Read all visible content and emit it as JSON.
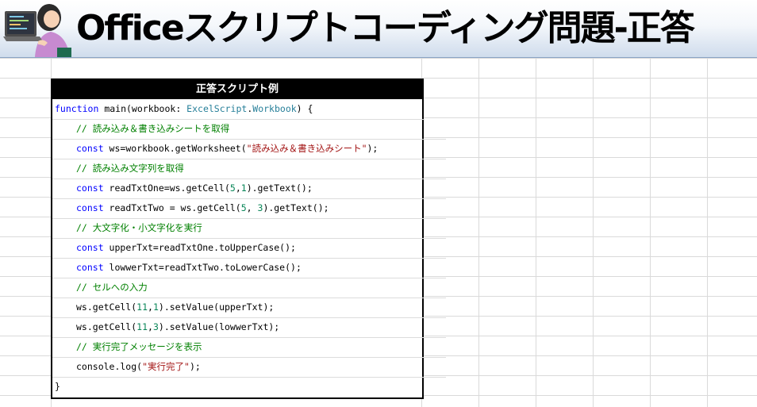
{
  "banner": {
    "title": "Officeスクリプトコーディング問題-正答"
  },
  "code_block": {
    "header": "正答スクリプト例",
    "lines": [
      {
        "indent": 0,
        "tokens": [
          {
            "t": "kw",
            "v": "function"
          },
          {
            "t": "pl",
            "v": " main(workbook: "
          },
          {
            "t": "ty",
            "v": "ExcelScript"
          },
          {
            "t": "pl",
            "v": "."
          },
          {
            "t": "ty",
            "v": "Workbook"
          },
          {
            "t": "pl",
            "v": ") {"
          }
        ]
      },
      {
        "indent": 1,
        "tokens": [
          {
            "t": "cm",
            "v": "// 読み込み＆書き込みシートを取得"
          }
        ]
      },
      {
        "indent": 1,
        "tokens": [
          {
            "t": "kw",
            "v": "const"
          },
          {
            "t": "pl",
            "v": " ws=workbook.getWorksheet("
          },
          {
            "t": "str",
            "v": "\"読み込み＆書き込みシート\""
          },
          {
            "t": "pl",
            "v": ");"
          }
        ]
      },
      {
        "indent": 1,
        "tokens": [
          {
            "t": "cm",
            "v": "// 読み込み文字列を取得"
          }
        ]
      },
      {
        "indent": 1,
        "tokens": [
          {
            "t": "kw",
            "v": "const"
          },
          {
            "t": "pl",
            "v": " readTxtOne=ws.getCell("
          },
          {
            "t": "num",
            "v": "5"
          },
          {
            "t": "pl",
            "v": ","
          },
          {
            "t": "num",
            "v": "1"
          },
          {
            "t": "pl",
            "v": ").getText();"
          }
        ]
      },
      {
        "indent": 1,
        "tokens": [
          {
            "t": "kw",
            "v": "const"
          },
          {
            "t": "pl",
            "v": " readTxtTwo = ws.getCell("
          },
          {
            "t": "num",
            "v": "5"
          },
          {
            "t": "pl",
            "v": ", "
          },
          {
            "t": "num",
            "v": "3"
          },
          {
            "t": "pl",
            "v": ").getText();"
          }
        ]
      },
      {
        "indent": 1,
        "tokens": [
          {
            "t": "cm",
            "v": "// 大文字化・小文字化を実行"
          }
        ]
      },
      {
        "indent": 1,
        "tokens": [
          {
            "t": "kw",
            "v": "const"
          },
          {
            "t": "pl",
            "v": " upperTxt=readTxtOne.toUpperCase();"
          }
        ]
      },
      {
        "indent": 1,
        "tokens": [
          {
            "t": "kw",
            "v": "const"
          },
          {
            "t": "pl",
            "v": " lowwerTxt=readTxtTwo.toLowerCase();"
          }
        ]
      },
      {
        "indent": 1,
        "tokens": [
          {
            "t": "cm",
            "v": "// セルへの入力"
          }
        ]
      },
      {
        "indent": 1,
        "tokens": [
          {
            "t": "pl",
            "v": "ws.getCell("
          },
          {
            "t": "num",
            "v": "11"
          },
          {
            "t": "pl",
            "v": ","
          },
          {
            "t": "num",
            "v": "1"
          },
          {
            "t": "pl",
            "v": ").setValue(upperTxt);"
          }
        ]
      },
      {
        "indent": 1,
        "tokens": [
          {
            "t": "pl",
            "v": "ws.getCell("
          },
          {
            "t": "num",
            "v": "11"
          },
          {
            "t": "pl",
            "v": ","
          },
          {
            "t": "num",
            "v": "3"
          },
          {
            "t": "pl",
            "v": ").setValue(lowwerTxt);"
          }
        ]
      },
      {
        "indent": 1,
        "tokens": [
          {
            "t": "cm",
            "v": "// 実行完了メッセージを表示"
          }
        ]
      },
      {
        "indent": 1,
        "tokens": [
          {
            "t": "pl",
            "v": "console.log("
          },
          {
            "t": "str",
            "v": "\"実行完了\""
          },
          {
            "t": "pl",
            "v": ");"
          }
        ]
      },
      {
        "indent": 0,
        "tokens": [
          {
            "t": "pl",
            "v": "}"
          }
        ]
      }
    ]
  },
  "colors": {
    "keyword": "#0000ff",
    "type": "#267f99",
    "string": "#a31515",
    "number": "#098658",
    "comment": "#008000",
    "header_bg": "#000000",
    "header_text": "#ffffff",
    "banner_gradient_bottom": "#cfdcec"
  },
  "icons": {
    "avatar": "person-at-laptop-illustration-icon"
  }
}
